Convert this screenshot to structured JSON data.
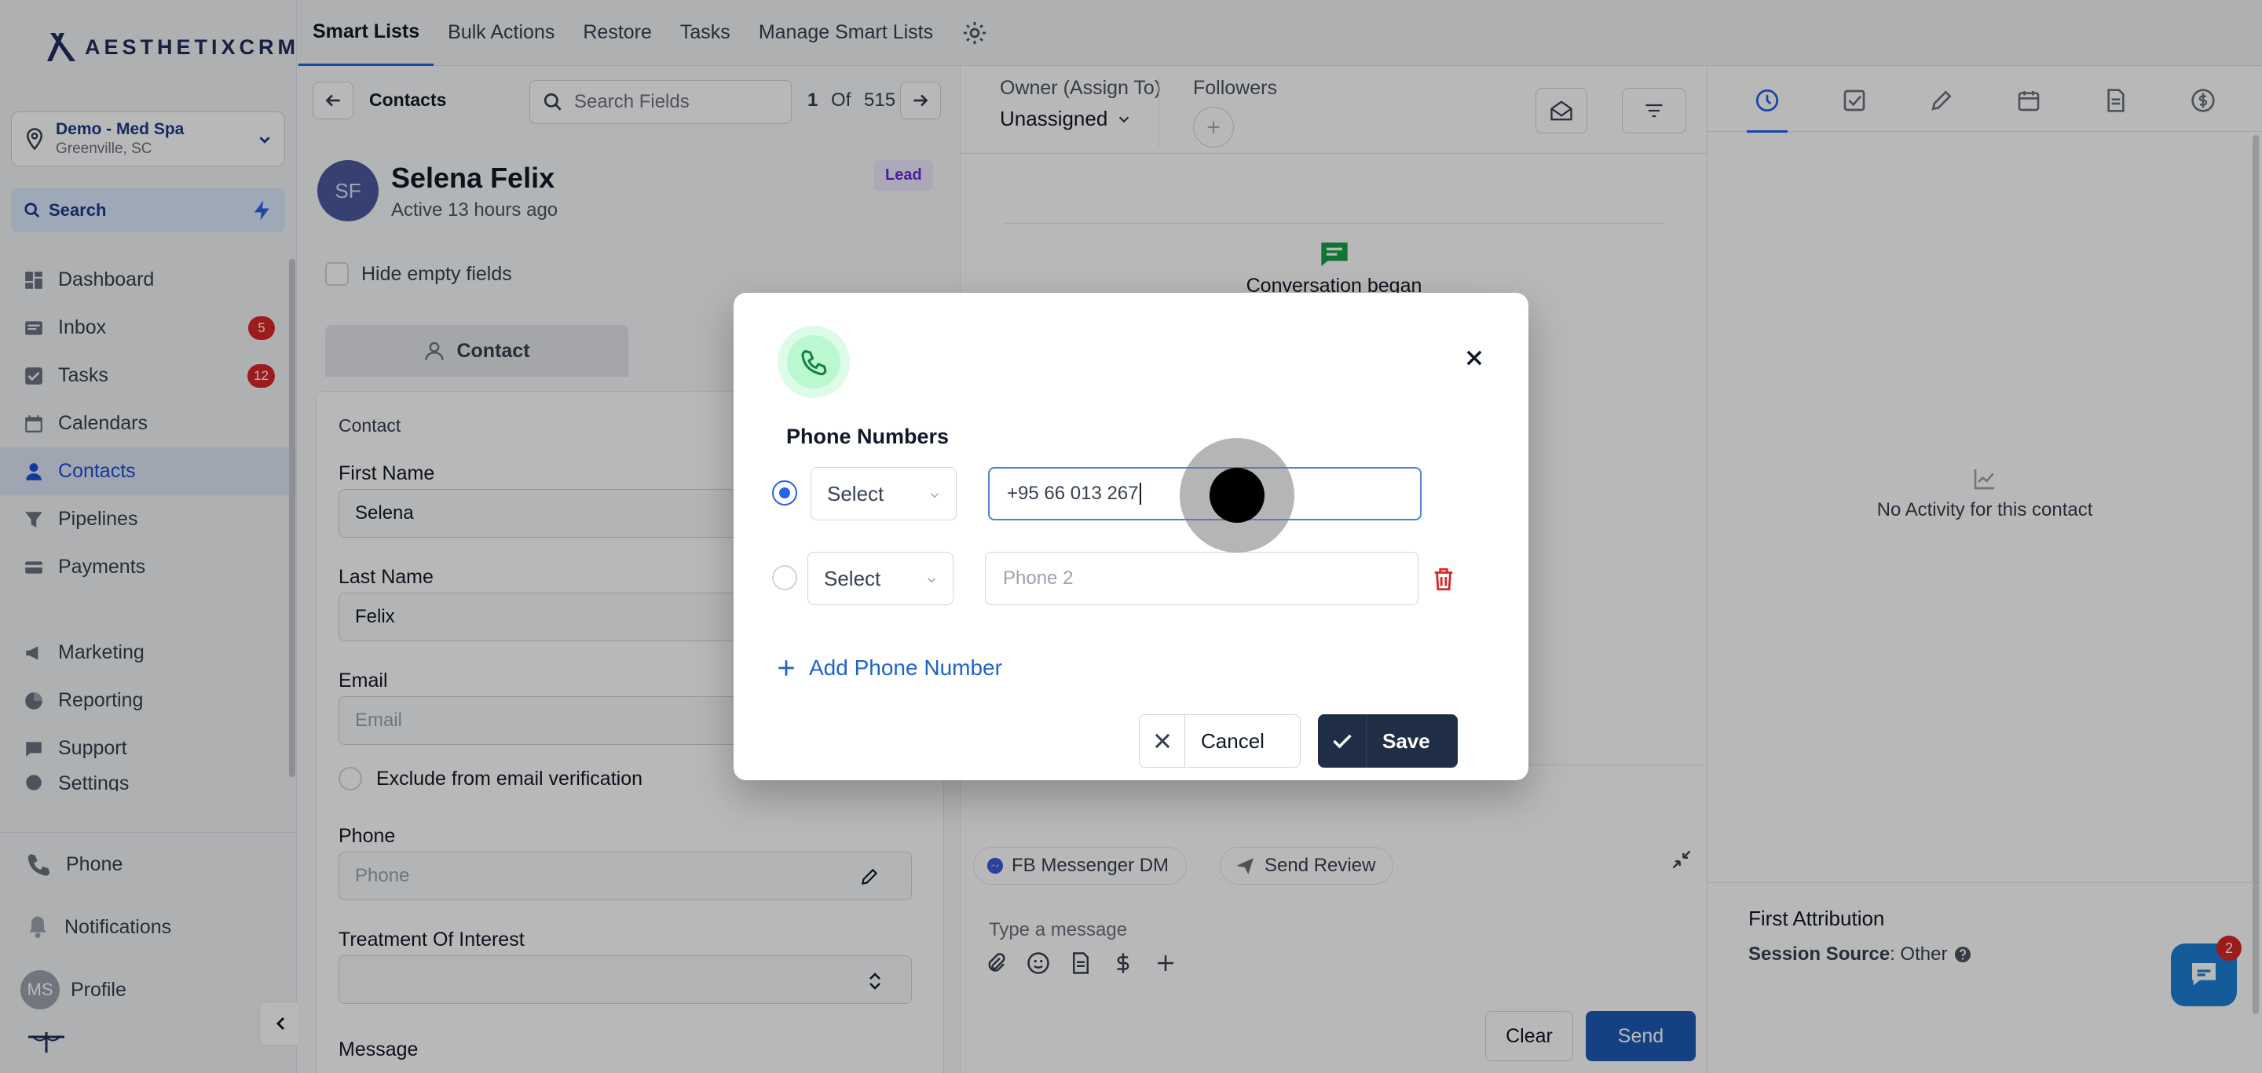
{
  "brand": {
    "logo_text": "AESTHETIXCRM"
  },
  "location": {
    "name": "Demo - Med Spa",
    "city": "Greenville, SC"
  },
  "search": {
    "label": "Search"
  },
  "sidebar": {
    "items": [
      {
        "label": "Dashboard",
        "icon": "dashboard-icon"
      },
      {
        "label": "Inbox",
        "icon": "inbox-icon",
        "badge": "5"
      },
      {
        "label": "Tasks",
        "icon": "tasks-icon",
        "badge": "12"
      },
      {
        "label": "Calendars",
        "icon": "calendar-icon"
      },
      {
        "label": "Contacts",
        "icon": "contacts-icon",
        "active": true
      },
      {
        "label": "Pipelines",
        "icon": "pipeline-icon"
      },
      {
        "label": "Payments",
        "icon": "payments-icon"
      }
    ],
    "secondary": [
      {
        "label": "Marketing",
        "icon": "megaphone-icon"
      },
      {
        "label": "Reporting",
        "icon": "chart-icon"
      },
      {
        "label": "Support",
        "icon": "support-icon"
      },
      {
        "label": "Settings",
        "icon": "settings-icon"
      }
    ],
    "bottom": {
      "phone": "Phone",
      "notifications": "Notifications",
      "profile": "Profile",
      "profile_initials": "MS"
    }
  },
  "topbar": {
    "tabs": [
      "Smart Lists",
      "Bulk Actions",
      "Restore",
      "Tasks",
      "Manage Smart Lists"
    ]
  },
  "contact_panel": {
    "title": "Contacts",
    "field_search_placeholder": "Search Fields",
    "pager": {
      "current": "1",
      "of": "Of",
      "total": "515"
    },
    "initials": "SF",
    "name": "Selena Felix",
    "active": "Active 13 hours ago",
    "status": "Lead",
    "hide_empty": "Hide empty fields",
    "tab": "Contact",
    "section": "Contact",
    "fields": {
      "first_name_label": "First Name",
      "first_name": "Selena",
      "last_name_label": "Last Name",
      "last_name": "Felix",
      "email_label": "Email",
      "email_placeholder": "Email",
      "exclude_label": "Exclude from email verification",
      "phone_label": "Phone",
      "phone_placeholder": "Phone",
      "treatment_label": "Treatment Of Interest",
      "message_label": "Message"
    }
  },
  "conversation": {
    "owner_label": "Owner (Assign To)",
    "owner_value": "Unassigned",
    "followers_label": "Followers",
    "began": "Conversation began",
    "chips": [
      "FB Messenger DM",
      "Send Review"
    ],
    "message_placeholder": "Type a message",
    "clear": "Clear",
    "send": "Send"
  },
  "activity": {
    "empty": "No Activity for this contact",
    "attribution_title": "First Attribution",
    "session_label": "Session Source",
    "session_value": ": Other",
    "help_badge": "2"
  },
  "modal": {
    "title": "Phone Numbers",
    "rows": [
      {
        "type": "Select",
        "value": "+95 66 013 267",
        "selected": true
      },
      {
        "type": "Select",
        "placeholder": "Phone 2",
        "selected": false
      }
    ],
    "add_label": "Add Phone Number",
    "cancel": "Cancel",
    "save": "Save"
  },
  "colors": {
    "accent": "#2563eb",
    "save_bg": "#1f2d45",
    "send_bg": "#1e5bb8",
    "badge": "#dc2626"
  }
}
